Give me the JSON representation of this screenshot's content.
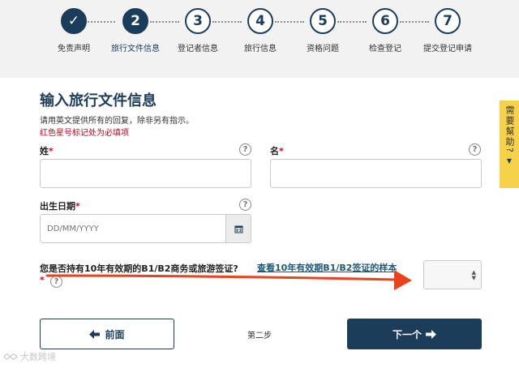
{
  "stepper": {
    "steps": [
      {
        "number": "✓",
        "label": "免责声明",
        "state": "done"
      },
      {
        "number": "2",
        "label": "旅行文件信息",
        "state": "active"
      },
      {
        "number": "3",
        "label": "登记者信息",
        "state": "todo"
      },
      {
        "number": "4",
        "label": "旅行信息",
        "state": "todo"
      },
      {
        "number": "5",
        "label": "资格问题",
        "state": "todo"
      },
      {
        "number": "6",
        "label": "检查登记",
        "state": "todo"
      },
      {
        "number": "7",
        "label": "提交登记申请",
        "state": "todo"
      }
    ]
  },
  "form": {
    "title": "输入旅行文件信息",
    "instructions": "请用英文提供所有的回复，除非另有指示。",
    "required_note": "红色星号标记处为必填项",
    "required_marker": "*",
    "help_glyph": "?",
    "surname": {
      "label": "姓",
      "value": ""
    },
    "given_name": {
      "label": "名",
      "value": ""
    },
    "dob": {
      "label": "出生日期",
      "placeholder": "DD/MM/YYYY",
      "value": ""
    },
    "visa_question": {
      "label": "您是否持有10年有效期的B1/B2商务或旅游签证?",
      "link": "查看10年有效期B1/B2签证的样本",
      "selected": ""
    }
  },
  "nav": {
    "back_label": "前面",
    "step_text": "第二步",
    "next_label": "下一个"
  },
  "help_tab": {
    "label": "需要幫助?"
  },
  "watermark": {
    "text": "大数跨境"
  },
  "colors": {
    "primary": "#1c3d5a",
    "required": "#d0021b",
    "help_tab": "#f6d14a",
    "annotation_arrow": "#e8421e"
  }
}
